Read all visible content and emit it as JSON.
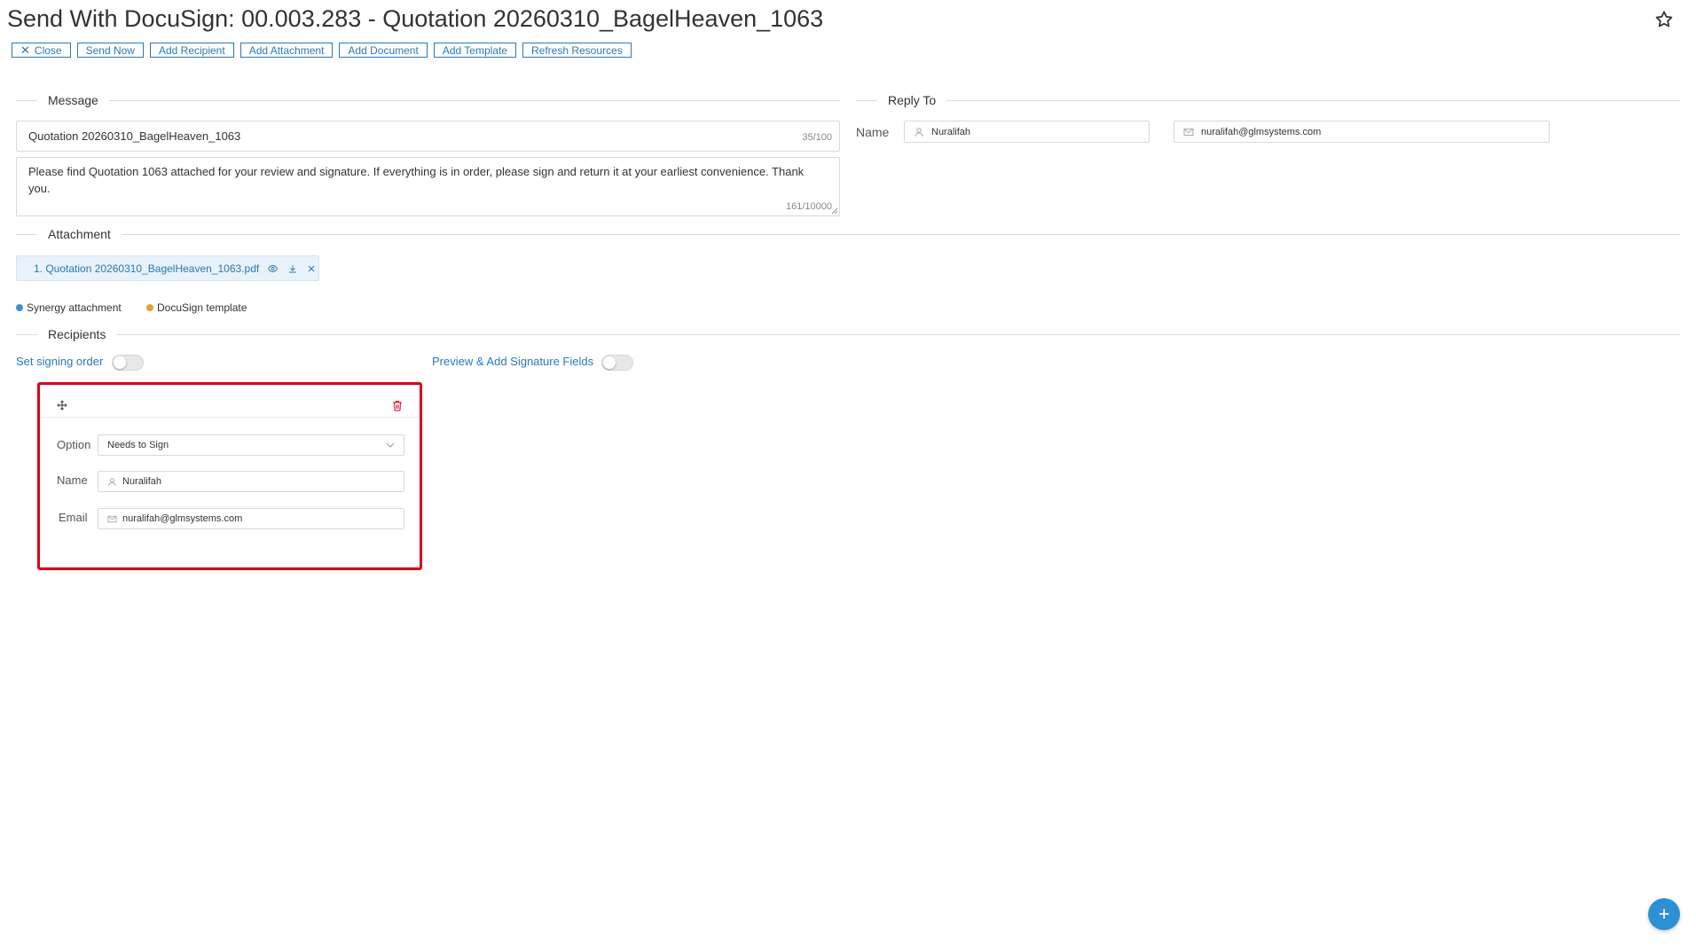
{
  "window": {
    "title": "Send With DocuSign: 00.003.283 - Quotation 20260310_BagelHeaven_1063"
  },
  "toolbar": {
    "close_label": "Close",
    "send_now_label": "Send Now",
    "add_recipient_label": "Add Recipient",
    "add_attachment_label": "Add Attachment",
    "add_document_label": "Add Document",
    "add_template_label": "Add Template",
    "refresh_resources_label": "Refresh Resources"
  },
  "message": {
    "section_label": "Message",
    "subject_value": "Quotation 20260310_BagelHeaven_1063",
    "subject_count": "35/100",
    "body_value": "Please find Quotation 1063 attached for your review and signature. If everything is in order, please sign and return it at your earliest convenience. Thank you.",
    "body_count": "161/10000"
  },
  "reply_to": {
    "section_label": "Reply To",
    "name_label": "Name",
    "name_value": "Nuralifah",
    "email_value": "nuralifah@glmsystems.com"
  },
  "attachment": {
    "section_label": "Attachment",
    "file_name": "1. Quotation 20260310_BagelHeaven_1063.pdf"
  },
  "legend": {
    "synergy_label": "Synergy attachment",
    "docusign_label": "DocuSign template",
    "synergy_color": "#3d8fd1",
    "docusign_color": "#e0a43a"
  },
  "recipients": {
    "section_label": "Recipients",
    "signing_order_label": "Set signing order",
    "preview_label": "Preview & Add Signature Fields",
    "card": {
      "option_label": "Option",
      "option_value": "Needs to Sign",
      "name_label": "Name",
      "name_value": "Nuralifah",
      "email_label": "Email",
      "email_value": "nuralifah@glmsystems.com"
    }
  },
  "colors": {
    "accent": "#2b78b5",
    "highlight": "#d9001b",
    "fab": "#2d8fd5",
    "delete": "#d9001b"
  },
  "fab": {
    "symbol": "+"
  }
}
